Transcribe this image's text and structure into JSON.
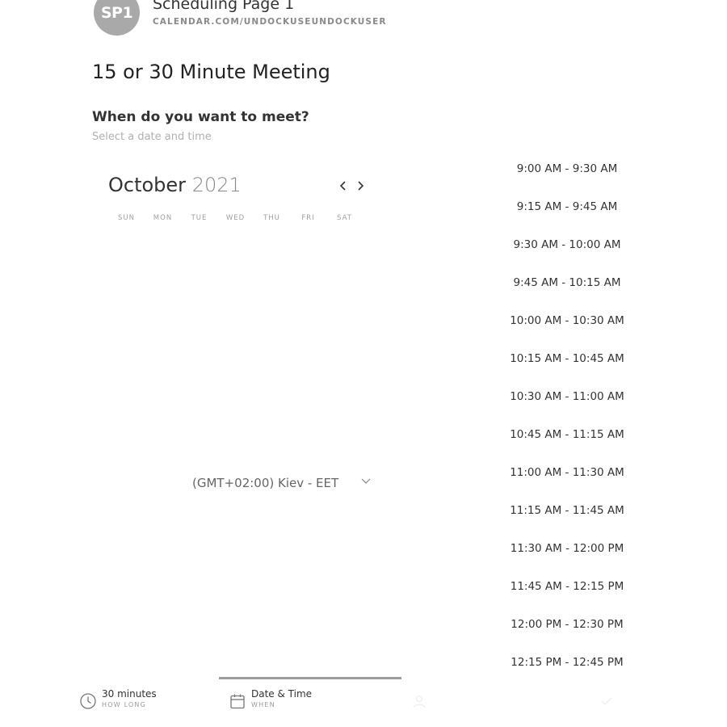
{
  "header": {
    "avatar_initials": "SP1",
    "page_name": "Scheduling Page 1",
    "page_url": "CALENDAR.COM/UNDOCKUSEUNDOCKUSER"
  },
  "meeting": {
    "title": "15 or 30 Minute Meeting",
    "question": "When do you want to meet?",
    "hint": "Select a date and time"
  },
  "calendar": {
    "month": "October",
    "year": "2021",
    "weekdays": [
      "SUN",
      "MON",
      "TUE",
      "WED",
      "THU",
      "FRI",
      "SAT"
    ]
  },
  "timezone": {
    "selected": "(GMT+02:00) Kiev - EET"
  },
  "time_slots": [
    "9:00 AM - 9:30 AM",
    "9:15 AM - 9:45 AM",
    "9:30 AM - 10:00 AM",
    "9:45 AM - 10:15 AM",
    "10:00 AM - 10:30 AM",
    "10:15 AM - 10:45 AM",
    "10:30 AM - 11:00 AM",
    "10:45 AM - 11:15 AM",
    "11:00 AM - 11:30 AM",
    "11:15 AM - 11:45 AM",
    "11:30 AM - 12:00 PM",
    "11:45 AM - 12:15 PM",
    "12:00 PM - 12:30 PM",
    "12:15 PM - 12:45 PM"
  ],
  "steps": [
    {
      "title": "30 minutes",
      "subtitle": "HOW LONG",
      "icon": "clock-icon",
      "state": "done"
    },
    {
      "title": "Date & Time",
      "subtitle": "WHEN",
      "icon": "calendar-icon",
      "state": "active"
    },
    {
      "title": "",
      "subtitle": "",
      "icon": "user-icon",
      "state": "upcoming"
    },
    {
      "title": "",
      "subtitle": "",
      "icon": "check-icon",
      "state": "upcoming"
    }
  ],
  "colors": {
    "avatar_bg": "#a9a9a9",
    "active_underline": "#9c9c9c",
    "muted_text": "#8a8a8a"
  }
}
